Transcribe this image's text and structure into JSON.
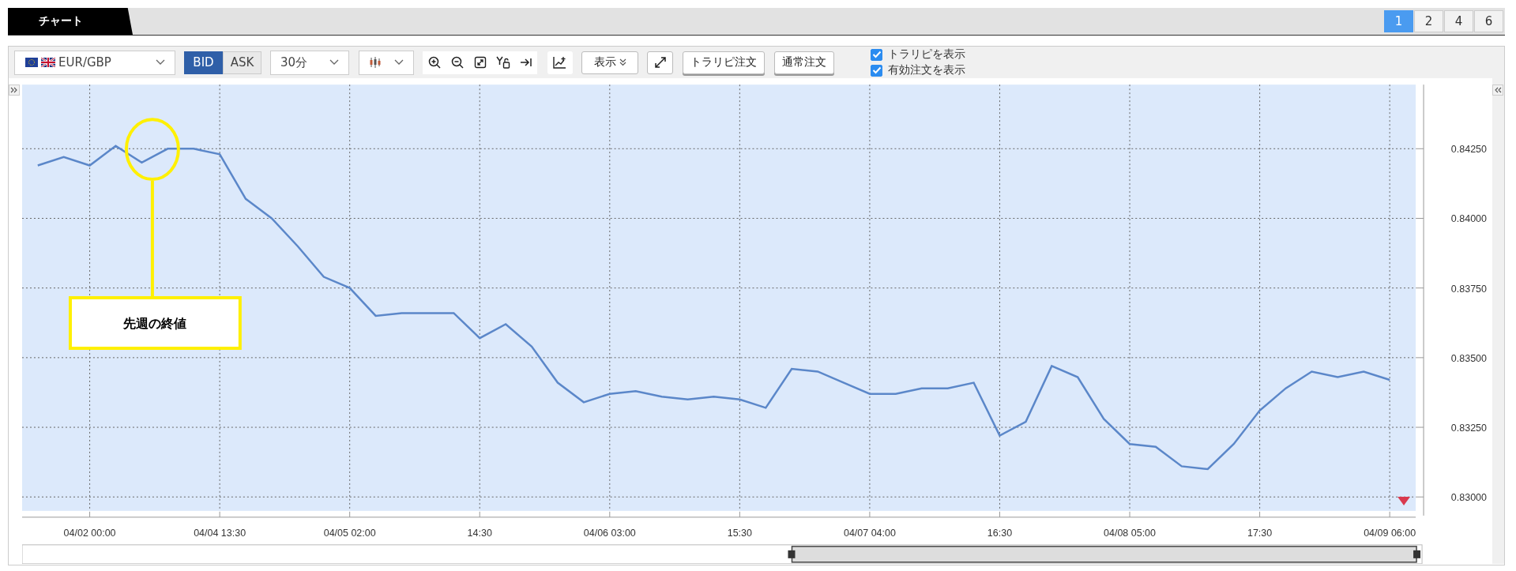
{
  "tabs": [
    {
      "label": "チャート",
      "selected": true
    }
  ],
  "layout_buttons": [
    {
      "label": "1",
      "selected": true
    },
    {
      "label": "2",
      "selected": false
    },
    {
      "label": "4",
      "selected": false
    },
    {
      "label": "6",
      "selected": false
    }
  ],
  "toolbar": {
    "pair": "EUR/GBP",
    "price_side": [
      {
        "label": "BID",
        "selected": true
      },
      {
        "label": "ASK",
        "selected": false
      }
    ],
    "interval": "30分",
    "display_menu": "表示",
    "order_buttons": [
      "トラリピ注文",
      "通常注文"
    ],
    "checkboxes": [
      {
        "label": "トラリピを表示",
        "checked": true
      },
      {
        "label": "有効注文を表示",
        "checked": true
      }
    ]
  },
  "chart": {
    "chart_data": {
      "type": "line",
      "grid": true,
      "ylim": [
        0.8295,
        0.8448
      ],
      "categories": [
        null,
        null,
        "04/02 00:00",
        null,
        null,
        null,
        null,
        "04/04 13:30",
        null,
        null,
        null,
        null,
        "04/05 02:00",
        null,
        null,
        null,
        null,
        "14:30",
        null,
        null,
        null,
        null,
        "04/06 03:00",
        null,
        null,
        null,
        null,
        "15:30",
        null,
        null,
        null,
        null,
        "04/07 04:00",
        null,
        null,
        null,
        null,
        "16:30",
        null,
        null,
        null,
        null,
        "04/08 05:00",
        null,
        null,
        null,
        null,
        "17:30",
        null,
        null,
        null,
        null,
        "04/09 06:00"
      ],
      "series": [
        {
          "color": "#5b87c9",
          "values": [
            0.8419,
            0.8422,
            0.8419,
            0.8426,
            0.842,
            0.8425,
            0.8425,
            0.8423,
            0.8407,
            0.84,
            0.839,
            0.8379,
            0.8375,
            0.8365,
            0.8366,
            0.8366,
            0.8366,
            0.8357,
            0.8362,
            0.8354,
            0.8341,
            0.8334,
            0.8337,
            0.8338,
            0.8336,
            0.8335,
            0.8336,
            0.8335,
            0.8332,
            0.8346,
            0.8345,
            0.8341,
            0.8337,
            0.8337,
            0.8339,
            0.8339,
            0.8341,
            0.8322,
            0.8327,
            0.8347,
            0.8343,
            0.8328,
            0.8319,
            0.8318,
            0.8311,
            0.831,
            0.8319,
            0.8331,
            0.8339,
            0.8345,
            0.8343,
            0.8345,
            0.8342
          ]
        }
      ],
      "yticks": [
        {
          "value": 0.8425,
          "label": "0.84250"
        },
        {
          "value": 0.84,
          "label": "0.84000"
        },
        {
          "value": 0.8375,
          "label": "0.83750"
        },
        {
          "value": 0.835,
          "label": "0.83500"
        },
        {
          "value": 0.8325,
          "label": "0.83250"
        },
        {
          "value": 0.83,
          "label": "0.83000"
        }
      ],
      "annotations": [
        "先週の終値"
      ]
    }
  }
}
